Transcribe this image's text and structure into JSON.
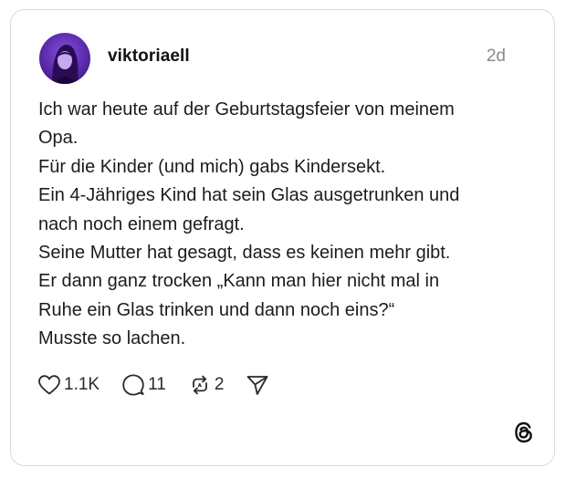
{
  "post": {
    "username": "viktoriaell",
    "time": "2d",
    "lines": [
      "Ich war heute auf der Geburtstagsfeier von meinem",
      "Opa.",
      "Für die Kinder (und mich) gabs Kindersekt.",
      "Ein 4-Jähriges Kind hat sein Glas ausgetrunken und",
      "nach noch einem gefragt.",
      "Seine Mutter hat gesagt, dass es keinen mehr gibt.",
      "Er dann ganz trocken „Kann man hier nicht mal in",
      "Ruhe ein Glas trinken und dann noch eins?“",
      "Musste so lachen."
    ]
  },
  "actions": {
    "likes": "1.1K",
    "replies": "11",
    "reposts": "2"
  },
  "icons": {
    "like": "heart-icon",
    "reply": "speech-bubble-icon",
    "repost": "repost-icon",
    "share": "send-icon",
    "brand": "threads-logo-icon"
  },
  "colors": {
    "text": "#1c1c1c",
    "muted": "#8a8a8a",
    "border": "#d9d9d9",
    "avatar_bg": "#6a2fc8"
  }
}
